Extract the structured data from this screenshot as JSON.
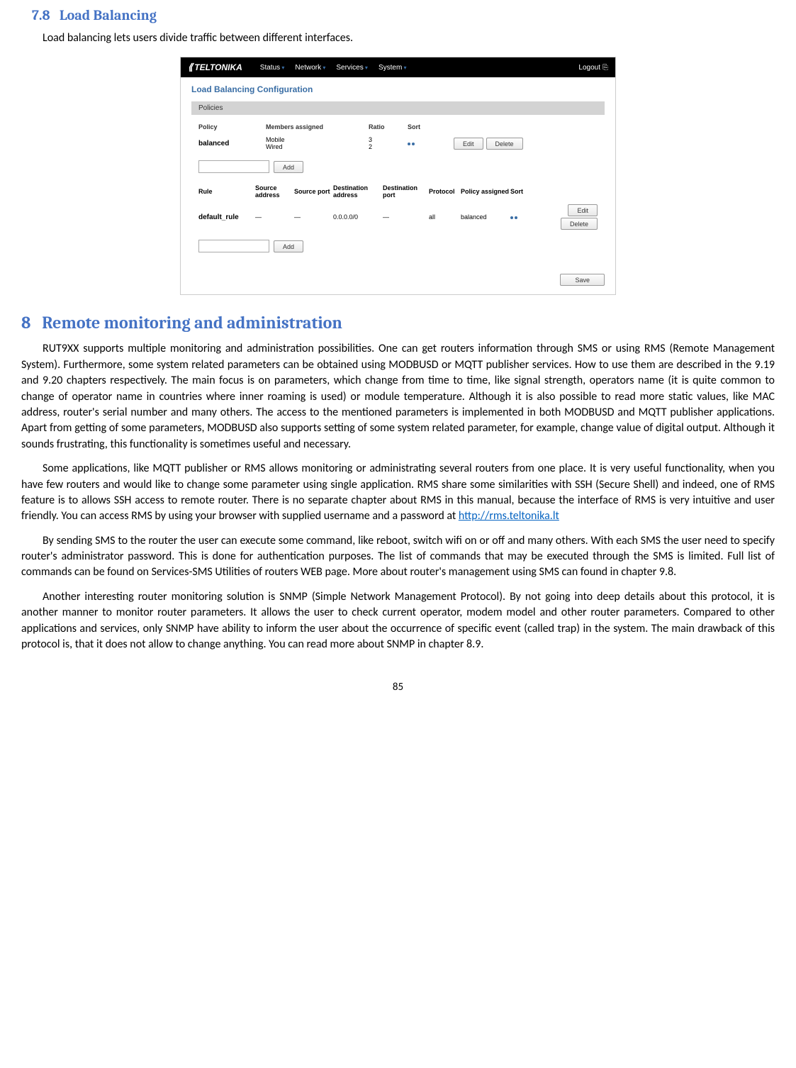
{
  "doc": {
    "section_7_8_num": "7.8",
    "section_7_8_title": "Load Balancing",
    "intro_7_8": "Load balancing lets users divide traffic between different interfaces.",
    "section_8_num": "8",
    "section_8_title": "Remote monitoring and administration",
    "para1": "RUT9XX supports multiple monitoring and administration possibilities. One can get routers information through SMS or using RMS (Remote Management System). Furthermore, some system related parameters can be obtained using MODBUSD or MQTT publisher services. How to use them are described in the 9.19 and 9.20 chapters respectively. The main focus is on parameters, which change from time to time, like signal strength, operators name (it is quite common to change of operator name in countries where inner roaming is used) or module temperature. Although it is also possible to read more static values, like MAC address, router's serial number and many others. The access to the mentioned parameters is implemented in both MODBUSD and MQTT publisher applications.  Apart from getting of some parameters, MODBUSD also supports setting of some system related parameter, for example, change value of digital output. Although it sounds frustrating, this functionality is sometimes useful and necessary.",
    "para2_pre": "Some applications, like MQTT publisher or RMS allows monitoring or administrating several routers from one place. It is very useful functionality, when you have few routers and would like to change some parameter using single application. RMS share some similarities with SSH (Secure Shell) and indeed, one of RMS feature is to allows SSH access to remote router.  There is no separate chapter about RMS in this manual, because the interface of RMS is very intuitive and user friendly. You can access RMS by using your browser with supplied username and a password at ",
    "para2_link": "http://rms.teltonika.lt",
    "para3": "By sending SMS to the router the user can execute some command, like reboot, switch wifi on or off and many others. With each SMS the user need to specify router's administrator password. This is done for authentication purposes. The list of commands that may be executed through the SMS is limited. Full list of commands can be found on Services-SMS Utilities of routers WEB page.  More about router's management using SMS can found in chapter 9.8.",
    "para4": "Another interesting router monitoring solution is SNMP (Simple Network Management Protocol). By not going into deep details about this protocol, it is another manner to monitor router parameters. It allows the user to check current operator, modem model and other router parameters. Compared to other applications and services, only SNMP have ability to inform the user about the occurrence of specific event (called trap) in the system. The main drawback of this protocol is, that it does not allow to change anything. You can read more about SNMP in chapter 8.9.",
    "page_number": "85"
  },
  "ui": {
    "logo": "TELTONIKA",
    "nav": {
      "status": "Status",
      "network": "Network",
      "services": "Services",
      "system": "System"
    },
    "logout": "Logout",
    "title": "Load Balancing Configuration",
    "policies_header": "Policies",
    "policy_cols": {
      "policy": "Policy",
      "members": "Members assigned",
      "ratio": "Ratio",
      "sort": "Sort"
    },
    "policy_row": {
      "name": "balanced",
      "member1": "Mobile",
      "member2": "Wired",
      "ratio1": "3",
      "ratio2": "2"
    },
    "rule_cols": {
      "rule": "Rule",
      "saddr": "Source address",
      "sport": "Source port",
      "daddr": "Destination address",
      "dport": "Destination port",
      "proto": "Protocol",
      "passign": "Policy assigned",
      "sort": "Sort"
    },
    "rule_row": {
      "name": "default_rule",
      "saddr": "—",
      "sport": "—",
      "daddr": "0.0.0.0/0",
      "dport": "—",
      "proto": "all",
      "passign": "balanced"
    },
    "buttons": {
      "edit": "Edit",
      "delete": "Delete",
      "add": "Add",
      "save": "Save"
    }
  }
}
